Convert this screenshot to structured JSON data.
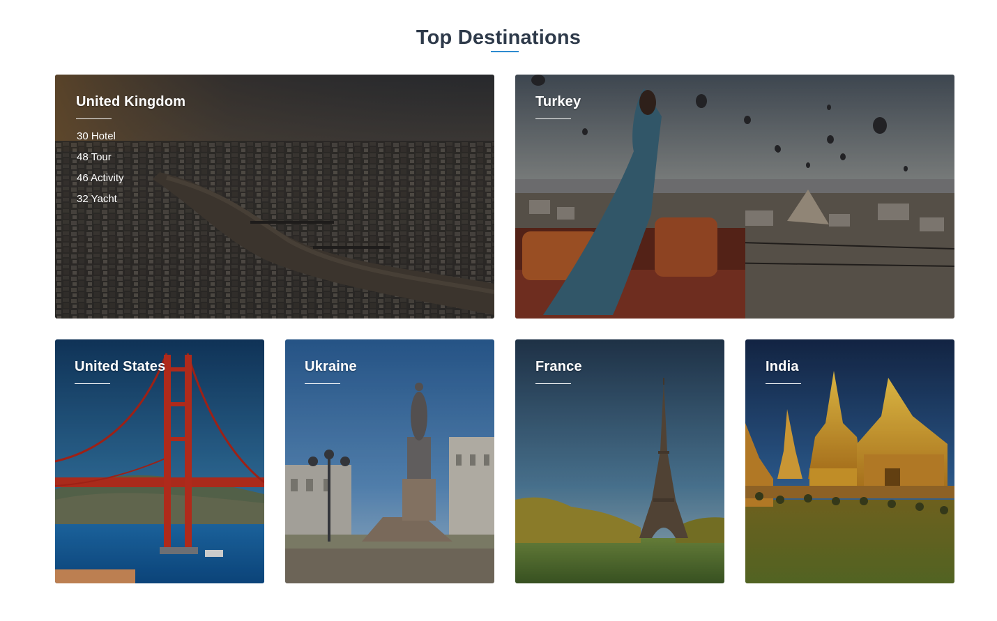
{
  "section": {
    "title": "Top Destinations",
    "accent_color": "#2d8bd0"
  },
  "destinations": [
    {
      "name": "United Kingdom",
      "stats": [
        "30 Hotel",
        "48 Tour",
        "46 Activity",
        "32 Yacht"
      ],
      "image": "aerial-city-river-photo"
    },
    {
      "name": "Turkey",
      "image": "woman-balloons-cappadocia-photo"
    },
    {
      "name": "United States",
      "image": "golden-gate-bridge-photo"
    },
    {
      "name": "Ukraine",
      "image": "monument-square-photo"
    },
    {
      "name": "France",
      "image": "eiffel-tower-photo"
    },
    {
      "name": "India",
      "image": "golden-temple-photo"
    }
  ]
}
